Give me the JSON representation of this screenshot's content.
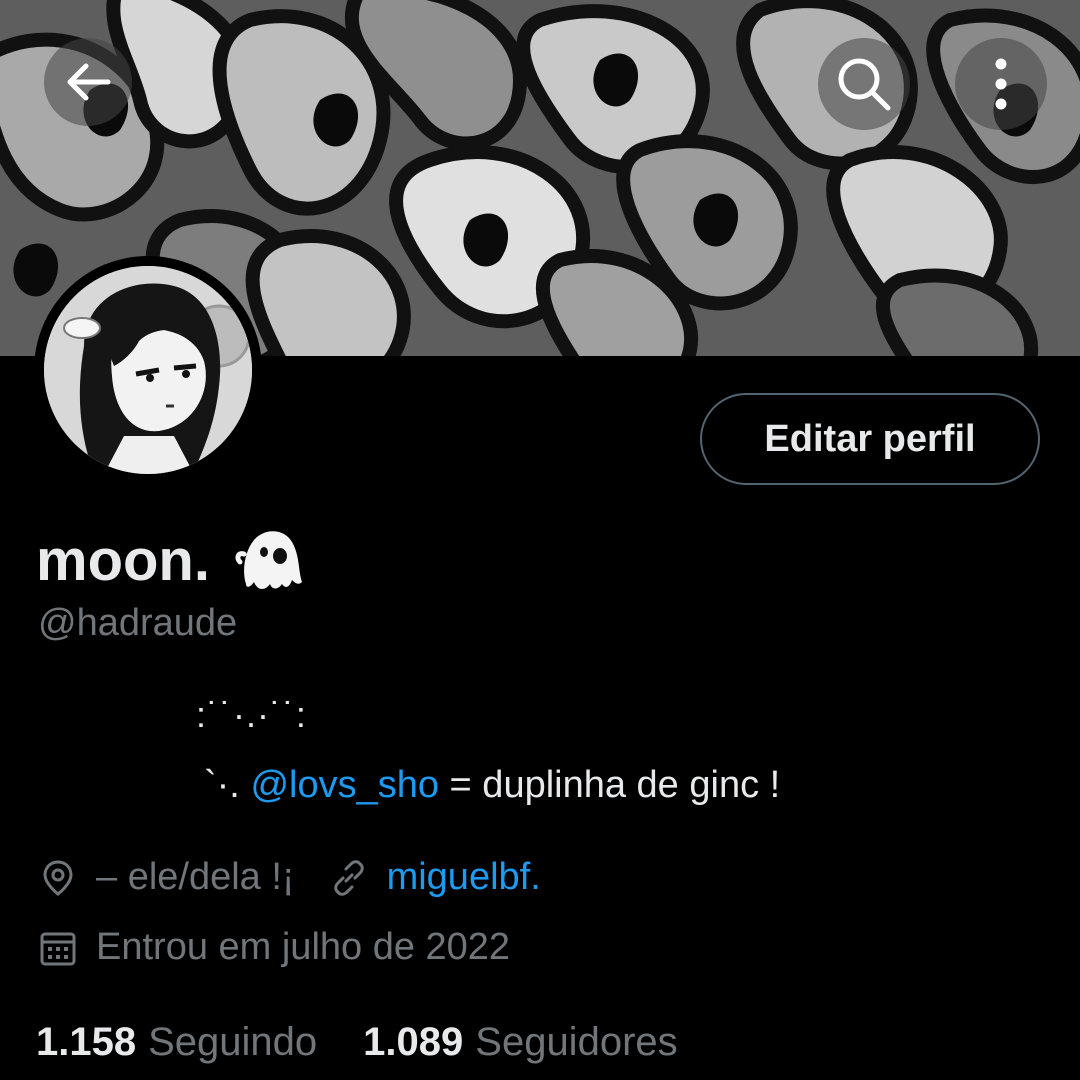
{
  "header": {
    "back_icon": "arrow-left-icon",
    "search_icon": "search-icon",
    "more_icon": "more-vertical-icon"
  },
  "profile": {
    "display_name": "moon.",
    "name_emoji": "ghost-icon",
    "handle": "@hadraude",
    "edit_button_label": "Editar perfil",
    "bio": {
      "line1": ":˙˙·.·˙˙:",
      "line2_prefix": "`·. ",
      "line2_mention": "@lovs_sho",
      "line2_suffix": " = duplinha de ginc !"
    },
    "location": "–  ele/dela !¡",
    "website": "miguelbf.",
    "joined": "Entrou em julho de 2022",
    "following_count": "1.158",
    "following_label": "Seguindo",
    "followers_count": "1.089",
    "followers_label": "Seguidores"
  },
  "colors": {
    "background": "#000000",
    "text": "#e7e9ea",
    "secondary_text": "#71767b",
    "accent": "#1d9bf0",
    "button_border": "#536471"
  }
}
